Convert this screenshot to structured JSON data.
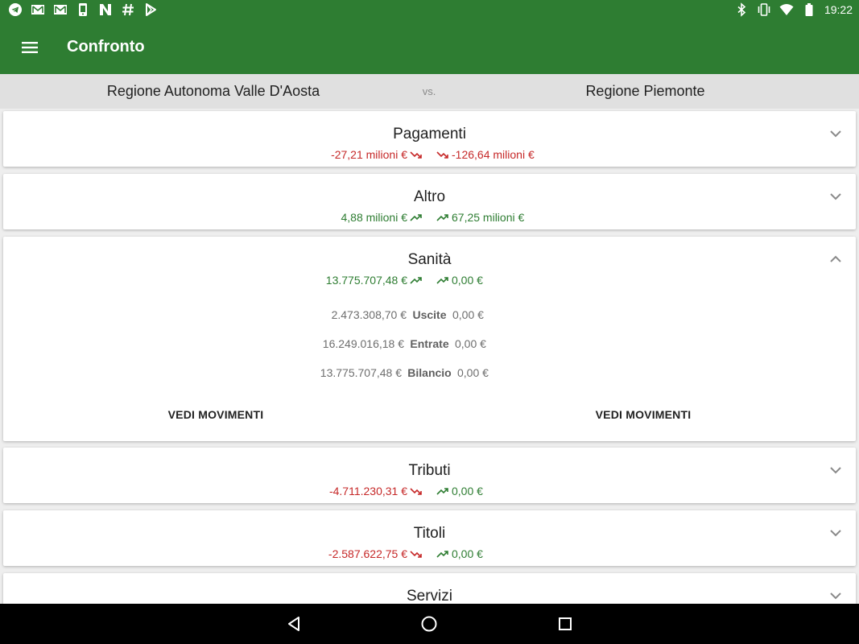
{
  "status_bar": {
    "time": "19:22",
    "left_icons": [
      "telegram-icon",
      "gmail-icon",
      "gmail-icon",
      "phone-icon",
      "n-app-icon",
      "hashtag-icon",
      "play-store-icon"
    ],
    "right_icons": [
      "bluetooth-icon",
      "vibrate-icon",
      "wifi-icon",
      "battery-icon"
    ]
  },
  "toolbar": {
    "title": "Confronto"
  },
  "compare": {
    "left": "Regione Autonoma Valle D'Aosta",
    "vs": "vs.",
    "right": "Regione Piemonte"
  },
  "colors": {
    "primary": "#2e7d32",
    "negative": "#c62828",
    "positive": "#2e7d32"
  },
  "cards": [
    {
      "title": "Pagamenti",
      "left": "-27,21 milioni €",
      "left_trend": "down",
      "right": "-126,64 milioni €",
      "right_trend": "down",
      "expanded": false
    },
    {
      "title": "Altro",
      "left": "4,88 milioni €",
      "left_trend": "up",
      "right": "67,25 milioni €",
      "right_trend": "up",
      "expanded": false
    },
    {
      "title": "Sanità",
      "left": "13.775.707,48 €",
      "left_trend": "up",
      "right": "0,00 €",
      "right_trend": "up",
      "expanded": true,
      "details": [
        {
          "left": "2.473.308,70 €",
          "label": "Uscite",
          "right": "0,00 €"
        },
        {
          "left": "16.249.016,18 €",
          "label": "Entrate",
          "right": "0,00 €"
        },
        {
          "left": "13.775.707,48 €",
          "label": "Bilancio",
          "right": "0,00 €"
        }
      ],
      "button_left": "VEDI MOVIMENTI",
      "button_right": "VEDI MOVIMENTI"
    },
    {
      "title": "Tributi",
      "left": "-4.711.230,31 €",
      "left_trend": "down",
      "right": "0,00 €",
      "right_trend": "up",
      "expanded": false
    },
    {
      "title": "Titoli",
      "left": "-2.587.622,75 €",
      "left_trend": "down",
      "right": "0,00 €",
      "right_trend": "up",
      "expanded": false
    },
    {
      "title": "Servizi",
      "expanded": false
    }
  ]
}
